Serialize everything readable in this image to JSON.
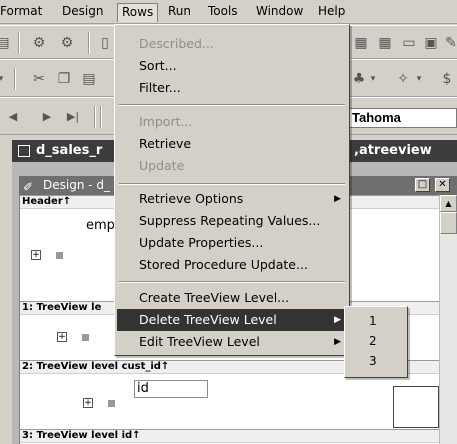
{
  "menubar": {
    "items": [
      "Format",
      "Design",
      "Rows",
      "Run",
      "Tools",
      "Window",
      "Help"
    ]
  },
  "toolbar": {
    "font_name": "Tahoma"
  },
  "datawindow": {
    "title": "d_sales_r",
    "title_right": ",atreeview dw"
  },
  "design": {
    "title": "Design - d_",
    "bands": {
      "header": "Header↑",
      "level1": "1: TreeView le",
      "level2": "2: TreeView level cust_id↑",
      "level3": "3: TreeView level id↑"
    },
    "fields": {
      "emp": "emp",
      "id": "id"
    }
  },
  "rows_menu": {
    "items": [
      {
        "label": "Described...",
        "disabled": true
      },
      {
        "label": "Sort...",
        "disabled": false
      },
      {
        "label": "Filter...",
        "disabled": false
      },
      {
        "label": "Import...",
        "disabled": true
      },
      {
        "label": "Retrieve",
        "disabled": false
      },
      {
        "label": "Update",
        "disabled": true
      },
      {
        "label": "Retrieve Options",
        "disabled": false,
        "submenu": true
      },
      {
        "label": "Suppress Repeating Values...",
        "disabled": false
      },
      {
        "label": "Update Properties...",
        "disabled": false
      },
      {
        "label": "Stored Procedure Update...",
        "disabled": false
      },
      {
        "label": "Create TreeView Level...",
        "disabled": false
      },
      {
        "label": "Delete TreeView Level",
        "disabled": false,
        "submenu": true,
        "highlighted": true
      },
      {
        "label": "Edit TreeView Level",
        "disabled": false,
        "submenu": true
      }
    ]
  },
  "submenu": {
    "items": [
      "1",
      "2",
      "3"
    ]
  }
}
